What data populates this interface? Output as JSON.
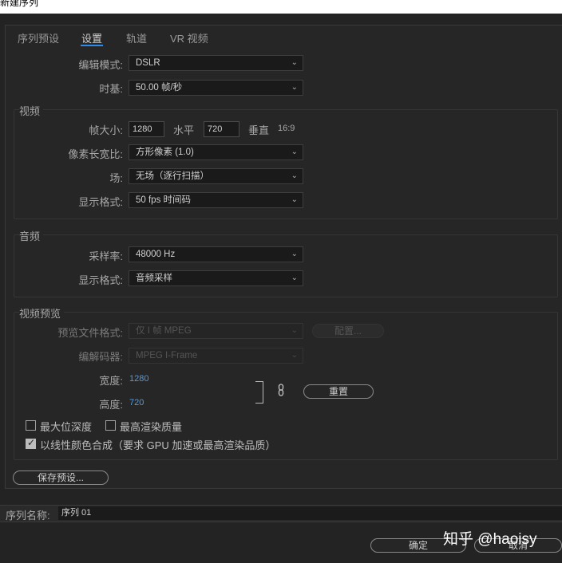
{
  "window": {
    "title": "新建序列"
  },
  "tabs": [
    {
      "label": "序列预设",
      "active": false
    },
    {
      "label": "设置",
      "active": true
    },
    {
      "label": "轨道",
      "active": false
    },
    {
      "label": "VR 视频",
      "active": false
    }
  ],
  "top": {
    "editing_mode": {
      "label": "编辑模式:",
      "value": "DSLR"
    },
    "timebase": {
      "label": "时基:",
      "value": "50.00  帧/秒"
    }
  },
  "video": {
    "title": "视频",
    "frame_size": {
      "label": "帧大小:",
      "width": "1280",
      "h_label": "水平",
      "height": "720",
      "v_label": "垂直",
      "ratio": "16:9"
    },
    "pixel_aspect": {
      "label": "像素长宽比:",
      "value": "方形像素 (1.0)"
    },
    "fields": {
      "label": "场:",
      "value": "无场（逐行扫描）"
    },
    "display_format": {
      "label": "显示格式:",
      "value": "50 fps 时间码"
    }
  },
  "audio": {
    "title": "音频",
    "sample_rate": {
      "label": "采样率:",
      "value": "48000 Hz"
    },
    "display_format": {
      "label": "显示格式:",
      "value": "音频采样"
    }
  },
  "preview": {
    "title": "视频预览",
    "file_format": {
      "label": "预览文件格式:",
      "value": "仅 I 帧 MPEG",
      "config_button": "配置..."
    },
    "codec": {
      "label": "编解码器:",
      "value": "MPEG I-Frame"
    },
    "width": {
      "label": "宽度:",
      "value": "1280"
    },
    "height": {
      "label": "高度:",
      "value": "720"
    },
    "reset_button": "重置",
    "max_bit_depth": {
      "label": "最大位深度",
      "checked": false
    },
    "max_render_quality": {
      "label": "最高渲染质量",
      "checked": false
    },
    "linear_color": {
      "label": "以线性颜色合成（要求 GPU 加速或最高渲染品质）",
      "checked": true
    }
  },
  "save_preset_button": "保存预设...",
  "sequence_name": {
    "label": "序列名称:",
    "value": "序列 01"
  },
  "footer": {
    "ok_button": "确定",
    "cancel_button": "取消"
  },
  "watermark": "知乎 @haoisy",
  "icons": {
    "chevron": "chevron-down-icon",
    "link": "link-icon"
  },
  "colors": {
    "accent": "#2d8ceb",
    "value_blue": "#4a9be8",
    "background": "#232323"
  }
}
